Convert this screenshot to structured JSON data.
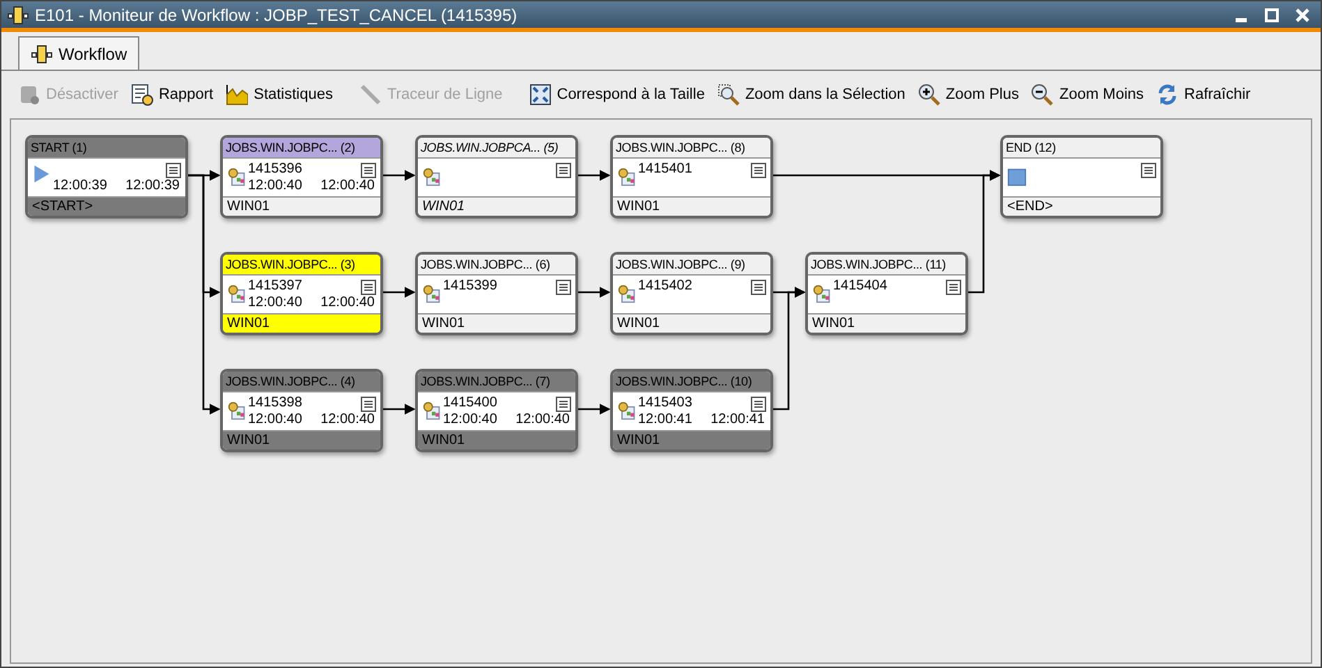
{
  "window": {
    "title": "E101 - Moniteur de Workflow : JOBP_TEST_CANCEL (1415395)"
  },
  "tabs": [
    {
      "label": "Workflow",
      "selected": true
    }
  ],
  "toolbar": [
    {
      "label": "Désactiver",
      "kind": "disable",
      "disabled": true
    },
    {
      "label": "Rapport",
      "kind": "report",
      "disabled": false
    },
    {
      "label": "Statistiques",
      "kind": "chart",
      "disabled": false
    },
    {
      "label": "Traceur de Ligne",
      "kind": "line",
      "disabled": true
    },
    {
      "label": "Correspond à la Taille",
      "kind": "fit",
      "disabled": false
    },
    {
      "label": "Zoom dans la Sélection",
      "kind": "zoomsel",
      "disabled": false
    },
    {
      "label": "Zoom Plus",
      "kind": "zoomin",
      "disabled": false
    },
    {
      "label": "Zoom Moins",
      "kind": "zoomout",
      "disabled": false
    },
    {
      "label": "Rafraîchir",
      "kind": "refresh",
      "disabled": false
    }
  ],
  "nodes": [
    {
      "title": "START (1)",
      "kind": "start",
      "color": "#7a7a7a",
      "footer_highlight": true,
      "skipped": false,
      "start": "12:00:39",
      "end": "12:00:39",
      "host": "<START>"
    },
    {
      "title": "JOBS.WIN.JOBPC... (2)",
      "kind": "job",
      "color": "#b3a6dc",
      "footer_highlight": false,
      "skipped": false,
      "id": "1415396",
      "start": "12:00:40",
      "end": "12:00:40",
      "host": "WIN01"
    },
    {
      "title": "JOBS.WIN.JOBPC... (3)",
      "kind": "job",
      "color": "#ffff00",
      "footer_highlight": true,
      "skipped": false,
      "id": "1415397",
      "start": "12:00:40",
      "end": "12:00:40",
      "host": "WIN01"
    },
    {
      "title": "JOBS.WIN.JOBPC... (4)",
      "kind": "job",
      "color": "#7a7a7a",
      "footer_highlight": true,
      "skipped": false,
      "id": "1415398",
      "start": "12:00:40",
      "end": "12:00:40",
      "host": "WIN01"
    },
    {
      "title": "JOBS.WIN.JOBPCA... (5)",
      "kind": "job",
      "color": "#f0f0f0",
      "footer_highlight": false,
      "skipped": true,
      "host": "WIN01"
    },
    {
      "title": "JOBS.WIN.JOBPC... (6)",
      "kind": "job",
      "color": "#f0f0f0",
      "footer_highlight": false,
      "skipped": false,
      "id": "1415399",
      "host": "WIN01"
    },
    {
      "title": "JOBS.WIN.JOBPC... (7)",
      "kind": "job",
      "color": "#7a7a7a",
      "footer_highlight": true,
      "skipped": false,
      "id": "1415400",
      "start": "12:00:40",
      "end": "12:00:40",
      "host": "WIN01"
    },
    {
      "title": "JOBS.WIN.JOBPC... (8)",
      "kind": "job",
      "color": "#f0f0f0",
      "footer_highlight": false,
      "skipped": false,
      "id": "1415401",
      "host": "WIN01"
    },
    {
      "title": "JOBS.WIN.JOBPC... (9)",
      "kind": "job",
      "color": "#f0f0f0",
      "footer_highlight": false,
      "skipped": false,
      "id": "1415402",
      "host": "WIN01"
    },
    {
      "title": "JOBS.WIN.JOBPC... (10)",
      "kind": "job",
      "color": "#7a7a7a",
      "footer_highlight": true,
      "skipped": false,
      "id": "1415403",
      "start": "12:00:41",
      "end": "12:00:41",
      "host": "WIN01"
    },
    {
      "title": "JOBS.WIN.JOBPC... (11)",
      "kind": "job",
      "color": "#f0f0f0",
      "footer_highlight": false,
      "skipped": false,
      "id": "1415404",
      "host": "WIN01"
    },
    {
      "title": "END (12)",
      "kind": "end",
      "color": "#f0f0f0",
      "footer_highlight": false,
      "skipped": false,
      "host": "<END>"
    }
  ]
}
